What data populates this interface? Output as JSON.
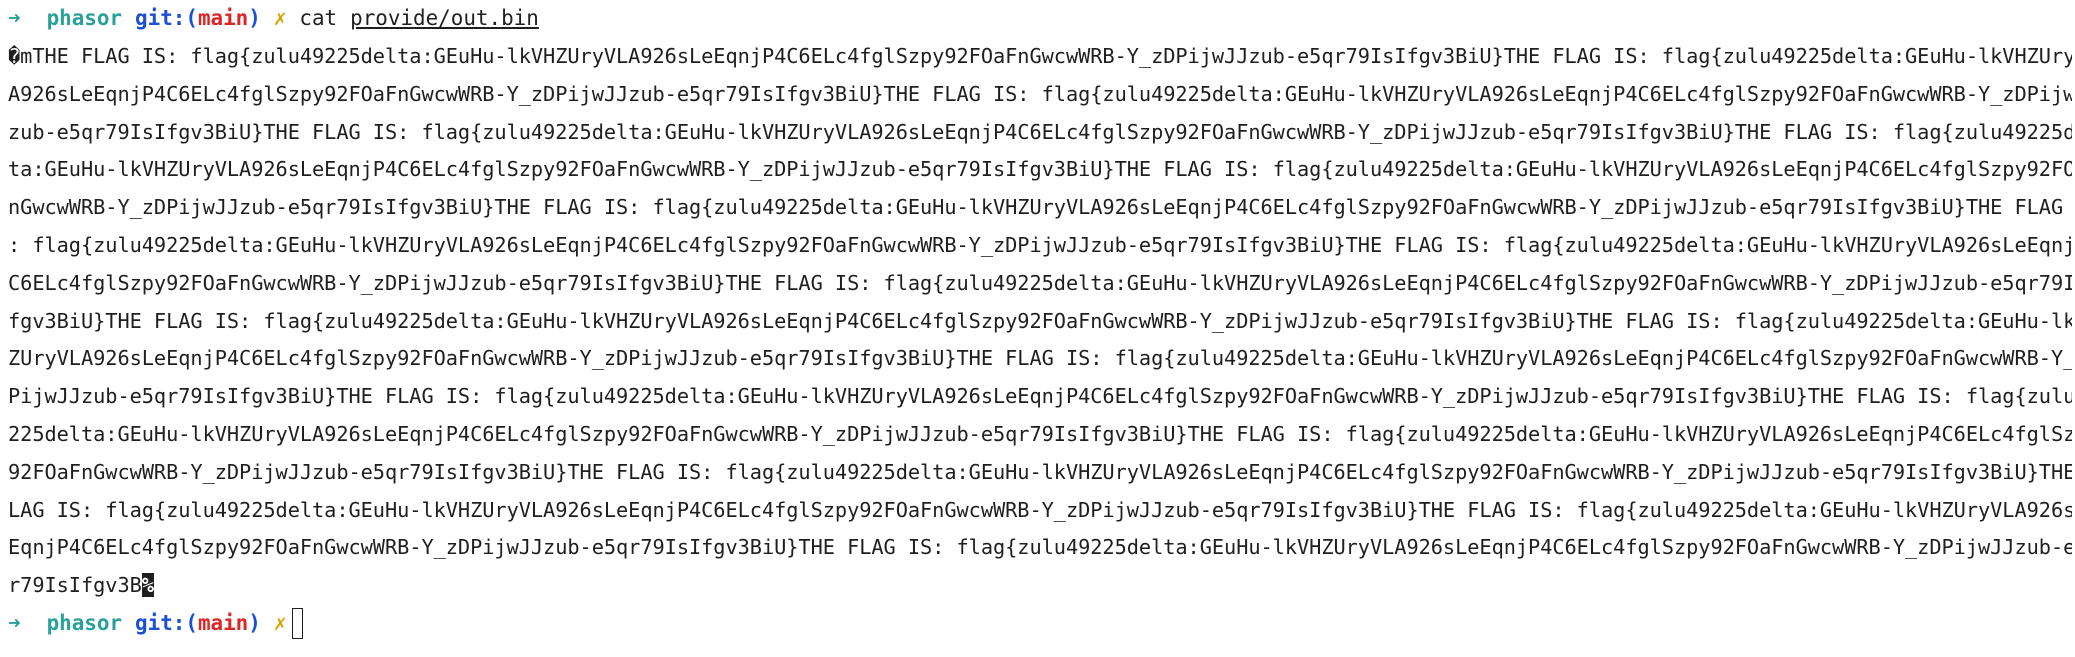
{
  "prompt": {
    "arrow": "➜",
    "directory": "phasor",
    "git_prefix": "git:(",
    "branch": "main",
    "git_suffix": ")",
    "dirty_marker": "✗"
  },
  "command": {
    "name": "cat",
    "argument": "provide/out.bin"
  },
  "output": {
    "lines": [
      "�mTHE FLAG IS: flag{zulu49225delta:GEuHu-lkVHZUryVLA926sLeEqnjP4C6ELc4fglSzpy92FOaFnGwcwWRB-Y_zDPijwJJzub-e5qr79IsIfgv3BiU}THE FLAG IS: flag{zulu49225delta:GEuHu-lkVHZUryVL",
      "A926sLeEqnjP4C6ELc4fglSzpy92FOaFnGwcwWRB-Y_zDPijwJJzub-e5qr79IsIfgv3BiU}THE FLAG IS: flag{zulu49225delta:GEuHu-lkVHZUryVLA926sLeEqnjP4C6ELc4fglSzpy92FOaFnGwcwWRB-Y_zDPijwJJ",
      "zub-e5qr79IsIfgv3BiU}THE FLAG IS: flag{zulu49225delta:GEuHu-lkVHZUryVLA926sLeEqnjP4C6ELc4fglSzpy92FOaFnGwcwWRB-Y_zDPijwJJzub-e5qr79IsIfgv3BiU}THE FLAG IS: flag{zulu49225del",
      "ta:GEuHu-lkVHZUryVLA926sLeEqnjP4C6ELc4fglSzpy92FOaFnGwcwWRB-Y_zDPijwJJzub-e5qr79IsIfgv3BiU}THE FLAG IS: flag{zulu49225delta:GEuHu-lkVHZUryVLA926sLeEqnjP4C6ELc4fglSzpy92FOaF",
      "nGwcwWRB-Y_zDPijwJJzub-e5qr79IsIfgv3BiU}THE FLAG IS: flag{zulu49225delta:GEuHu-lkVHZUryVLA926sLeEqnjP4C6ELc4fglSzpy92FOaFnGwcwWRB-Y_zDPijwJJzub-e5qr79IsIfgv3BiU}THE FLAG IS",
      ": flag{zulu49225delta:GEuHu-lkVHZUryVLA926sLeEqnjP4C6ELc4fglSzpy92FOaFnGwcwWRB-Y_zDPijwJJzub-e5qr79IsIfgv3BiU}THE FLAG IS: flag{zulu49225delta:GEuHu-lkVHZUryVLA926sLeEqnjP4",
      "C6ELc4fglSzpy92FOaFnGwcwWRB-Y_zDPijwJJzub-e5qr79IsIfgv3BiU}THE FLAG IS: flag{zulu49225delta:GEuHu-lkVHZUryVLA926sLeEqnjP4C6ELc4fglSzpy92FOaFnGwcwWRB-Y_zDPijwJJzub-e5qr79IsI",
      "fgv3BiU}THE FLAG IS: flag{zulu49225delta:GEuHu-lkVHZUryVLA926sLeEqnjP4C6ELc4fglSzpy92FOaFnGwcwWRB-Y_zDPijwJJzub-e5qr79IsIfgv3BiU}THE FLAG IS: flag{zulu49225delta:GEuHu-lkVH",
      "ZUryVLA926sLeEqnjP4C6ELc4fglSzpy92FOaFnGwcwWRB-Y_zDPijwJJzub-e5qr79IsIfgv3BiU}THE FLAG IS: flag{zulu49225delta:GEuHu-lkVHZUryVLA926sLeEqnjP4C6ELc4fglSzpy92FOaFnGwcwWRB-Y_zD",
      "PijwJJzub-e5qr79IsIfgv3BiU}THE FLAG IS: flag{zulu49225delta:GEuHu-lkVHZUryVLA926sLeEqnjP4C6ELc4fglSzpy92FOaFnGwcwWRB-Y_zDPijwJJzub-e5qr79IsIfgv3BiU}THE FLAG IS: flag{zulu49",
      "225delta:GEuHu-lkVHZUryVLA926sLeEqnjP4C6ELc4fglSzpy92FOaFnGwcwWRB-Y_zDPijwJJzub-e5qr79IsIfgv3BiU}THE FLAG IS: flag{zulu49225delta:GEuHu-lkVHZUryVLA926sLeEqnjP4C6ELc4fglSzpy",
      "92FOaFnGwcwWRB-Y_zDPijwJJzub-e5qr79IsIfgv3BiU}THE FLAG IS: flag{zulu49225delta:GEuHu-lkVHZUryVLA926sLeEqnjP4C6ELc4fglSzpy92FOaFnGwcwWRB-Y_zDPijwJJzub-e5qr79IsIfgv3BiU}THE F",
      "LAG IS: flag{zulu49225delta:GEuHu-lkVHZUryVLA926sLeEqnjP4C6ELc4fglSzpy92FOaFnGwcwWRB-Y_zDPijwJJzub-e5qr79IsIfgv3BiU}THE FLAG IS: flag{zulu49225delta:GEuHu-lkVHZUryVLA926sLe",
      "EqnjP4C6ELc4fglSzpy92FOaFnGwcwWRB-Y_zDPijwJJzub-e5qr79IsIfgv3BiU}THE FLAG IS: flag{zulu49225delta:GEuHu-lkVHZUryVLA926sLeEqnjP4C6ELc4fglSzpy92FOaFnGwcwWRB-Y_zDPijwJJzub-e5q"
    ],
    "last_line": "r79IsIfgv3B",
    "eol_marker": "%"
  }
}
